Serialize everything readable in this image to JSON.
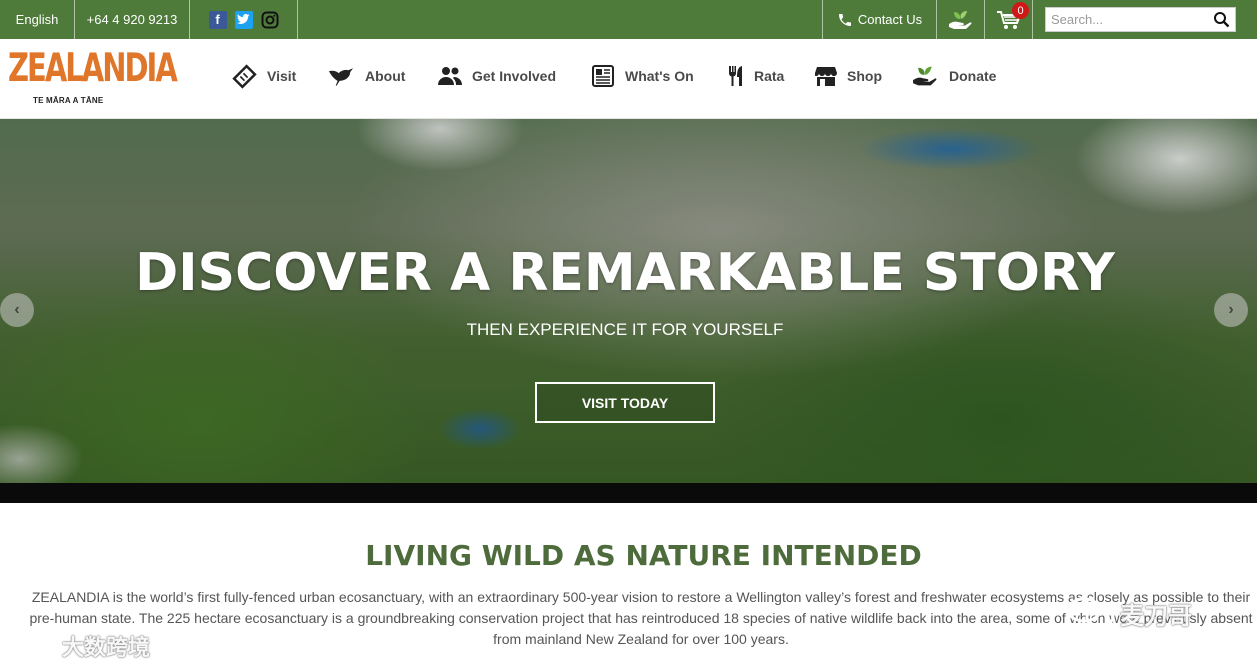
{
  "topbar": {
    "language": "English",
    "phone": "+64 4 920 9213",
    "social": [
      {
        "name": "facebook-icon",
        "glyph": "f"
      },
      {
        "name": "twitter-icon",
        "glyph": "t"
      },
      {
        "name": "instagram-icon",
        "glyph": ""
      }
    ],
    "contact_label": "Contact Us",
    "cart_count": "0",
    "search_placeholder": "Search..."
  },
  "logo": {
    "word": "ZEALANDIA",
    "tagline": "TE MĀRA A TĀNE"
  },
  "nav": {
    "items": [
      {
        "label": "Visit",
        "icon": "ticket-icon"
      },
      {
        "label": "About",
        "icon": "bird-icon"
      },
      {
        "label": "Get Involved",
        "icon": "people-icon"
      },
      {
        "label": "What's On",
        "icon": "newspaper-icon"
      },
      {
        "label": "Rata",
        "icon": "cutlery-icon"
      },
      {
        "label": "Shop",
        "icon": "shop-icon"
      },
      {
        "label": "Donate",
        "icon": "donate-icon"
      }
    ]
  },
  "hero": {
    "title": "DISCOVER A REMARKABLE STORY",
    "subtitle": "THEN EXPERIENCE IT FOR YOURSELF",
    "button": "VISIT TODAY"
  },
  "content": {
    "heading": "LIVING WILD AS NATURE INTENDED",
    "intro": "ZEALANDIA is the world’s first fully-fenced urban ecosanctuary, with an extraordinary 500-year vision to restore a Wellington valley’s forest and freshwater ecosystems as closely as possible to their pre-human state. The 225 hectare ecosanctuary is a groundbreaking conservation project that has reintroduced 18 species of native wildlife back into the area, some of which were previously absent from mainland New Zealand for over 100 years."
  },
  "watermarks": {
    "left": "大数跨境",
    "right": "麦刀哥"
  },
  "colors": {
    "brand_green": "#4e7a3a",
    "logo_orange": "#e0762a",
    "heading_green": "#4e6b3c",
    "badge_red": "#d01818"
  }
}
